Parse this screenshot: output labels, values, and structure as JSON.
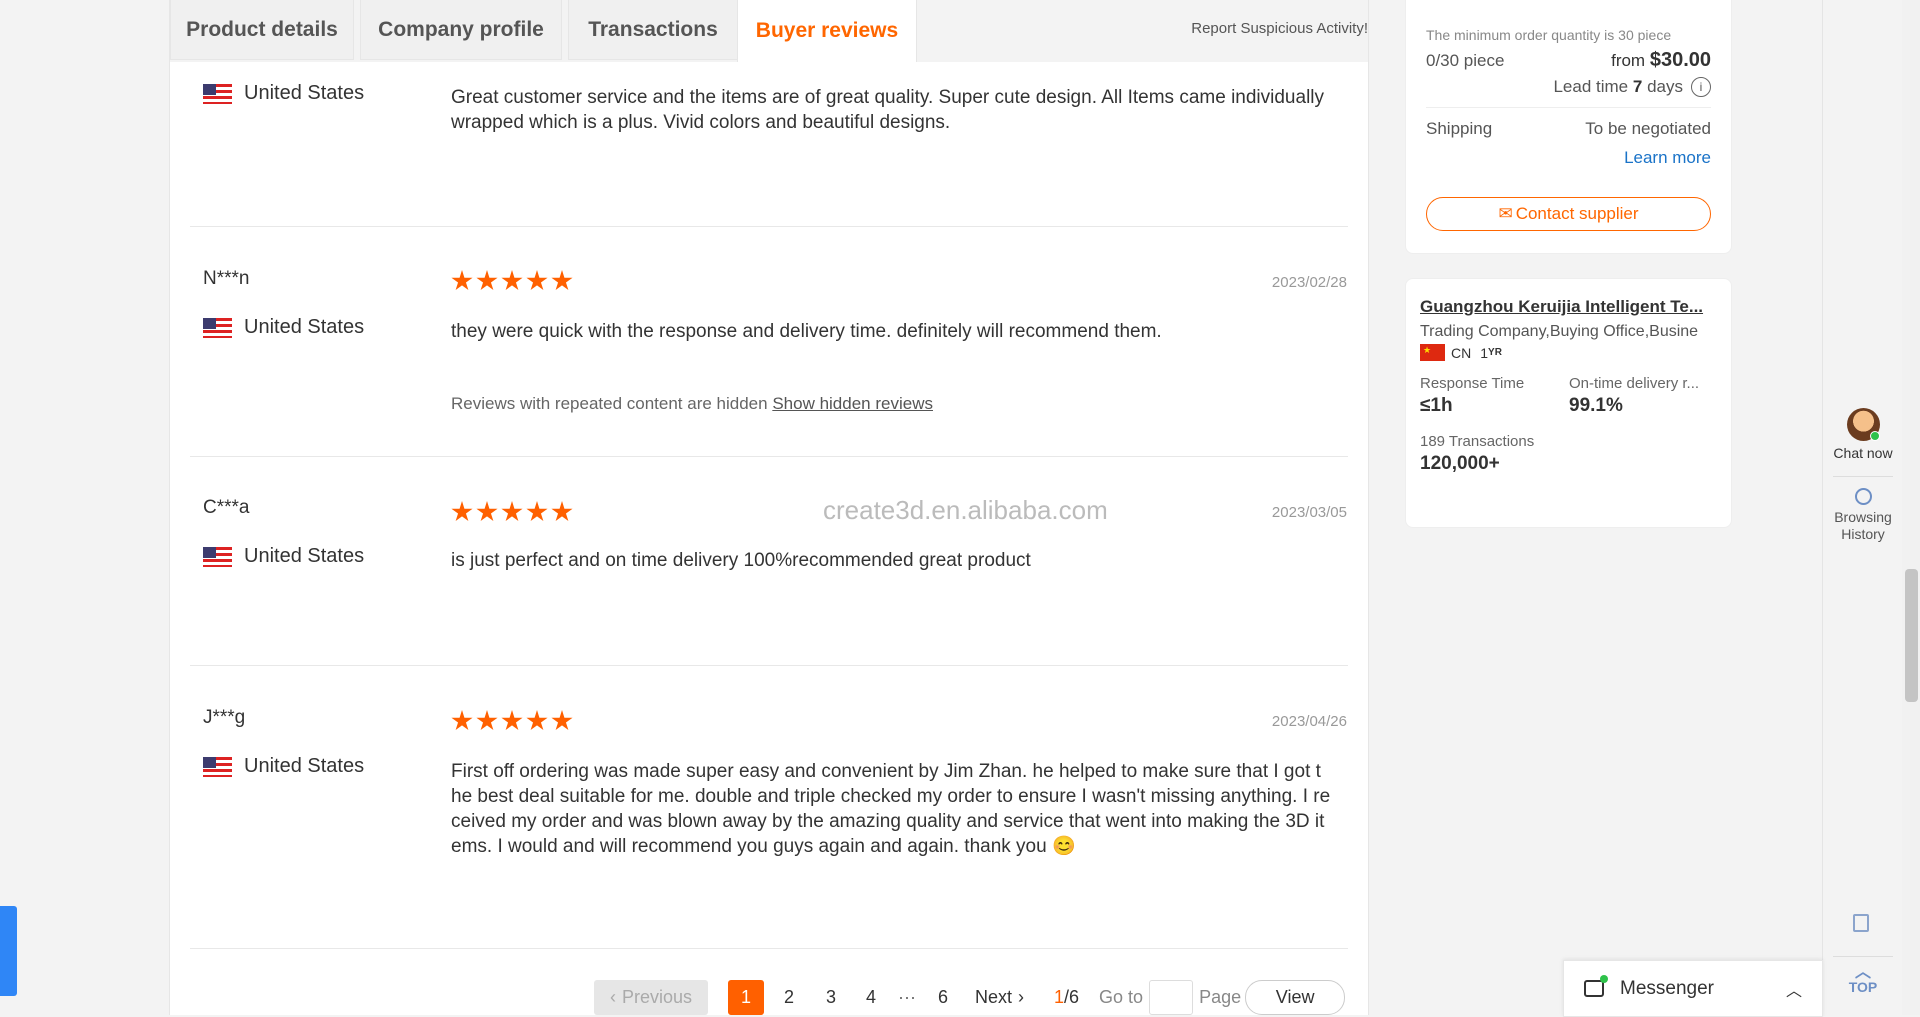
{
  "tabs": [
    {
      "label": "Product details"
    },
    {
      "label": "Company profile"
    },
    {
      "label": "Transactions"
    },
    {
      "label": "Buyer reviews"
    }
  ],
  "report_link": "Report Suspicious Activity!",
  "reviews": [
    {
      "name": "",
      "country": "United States",
      "date": "",
      "text": "Great customer service and the items are of great quality. Super cute design. All Items came individually wrapped which is a plus. Vivid colors and beautiful designs."
    },
    {
      "name": "N***n",
      "country": "United States",
      "date": "2023/02/28",
      "text": "they were quick with the response and delivery time. definitely will recommend them.",
      "hidden_note": "Reviews with repeated content are hidden",
      "hidden_link": "Show hidden reviews"
    },
    {
      "name": "C***a",
      "country": "United States",
      "date": "2023/03/05",
      "text": "is just perfect and on time delivery 100%recommended great product"
    },
    {
      "name": "J***g",
      "country": "United States",
      "date": "2023/04/26",
      "text": "First off ordering was made super easy and convenient by Jim Zhan. he helped to make sure that I got the best deal suitable for me. double and triple checked my order to ensure I wasn't missing anything. I received my order and was blown away by the amazing quality and service that went into making the 3D items. I would and will recommend you guys again and again. thank you 😊"
    }
  ],
  "watermark": "create3d.en.alibaba.com",
  "pagination": {
    "previous": "Previous",
    "pages": [
      "1",
      "2",
      "3",
      "4",
      "6"
    ],
    "ellipsis": "···",
    "next": "Next",
    "current": "1",
    "total": "/6",
    "goto": "Go to",
    "page": "Page",
    "view": "View"
  },
  "order": {
    "min_text": "The minimum order quantity is 30 piece",
    "progress": "0/30 piece",
    "from": "from",
    "price": "$30.00",
    "lead_label": "Lead time",
    "lead_value": "7",
    "lead_unit": "days",
    "shipping_label": "Shipping",
    "shipping_value": "To be negotiated",
    "learn_more": "Learn more",
    "contact": "Contact supplier"
  },
  "company": {
    "name": "Guangzhou Keruijia Intelligent Te...",
    "type": "Trading Company,Buying Office,Busine",
    "country": "CN",
    "years": "1",
    "years_unit": "YR",
    "response_label": "Response Time",
    "response_value": "≤1h",
    "ontime_label": "On-time delivery r...",
    "ontime_value": "99.1%",
    "transactions_label": "189 Transactions",
    "transactions_value": "120,000+"
  },
  "rail": {
    "chat": "Chat now",
    "history1": "Browsing",
    "history2": "History",
    "top": "TOP"
  },
  "messenger": {
    "label": "Messenger"
  },
  "colors": {
    "accent": "#ff6600",
    "link": "#1a73c8"
  }
}
